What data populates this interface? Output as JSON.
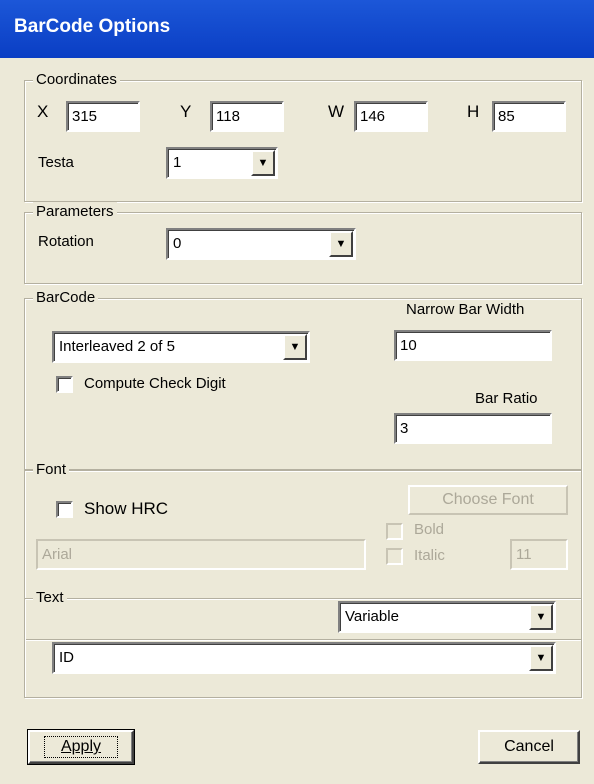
{
  "window": {
    "title": "BarCode Options"
  },
  "coordinates": {
    "legend": "Coordinates",
    "x_label": "X",
    "x_value": "315",
    "y_label": "Y",
    "y_value": "118",
    "w_label": "W",
    "w_value": "146",
    "h_label": "H",
    "h_value": "85",
    "testa_label": "Testa",
    "testa_value": "1"
  },
  "parameters": {
    "legend": "Parameters",
    "rotation_label": "Rotation",
    "rotation_value": "0"
  },
  "barcode": {
    "legend": "BarCode",
    "type_value": "Interleaved 2 of 5",
    "check_digit_label": "Compute Check Digit",
    "check_digit_checked": false,
    "narrow_bar_label": "Narrow Bar Width",
    "narrow_bar_value": "10",
    "bar_ratio_label": "Bar Ratio",
    "bar_ratio_value": "3"
  },
  "font": {
    "legend": "Font",
    "show_hrc_label": "Show HRC",
    "show_hrc_checked": false,
    "choose_font_label": "Choose Font",
    "font_name_value": "Arial",
    "bold_label": "Bold",
    "italic_label": "Italic",
    "size_value": "11"
  },
  "text": {
    "legend": "Text",
    "mode_value": "Variable",
    "field_value": "ID"
  },
  "buttons": {
    "apply_label": "Apply",
    "cancel_label": "Cancel"
  },
  "colors": {
    "titlebar": "#0a3ec4",
    "face": "#ece9d8",
    "disabled_text": "#aca899"
  },
  "icons": {
    "dropdown": "chevron-down-icon"
  }
}
